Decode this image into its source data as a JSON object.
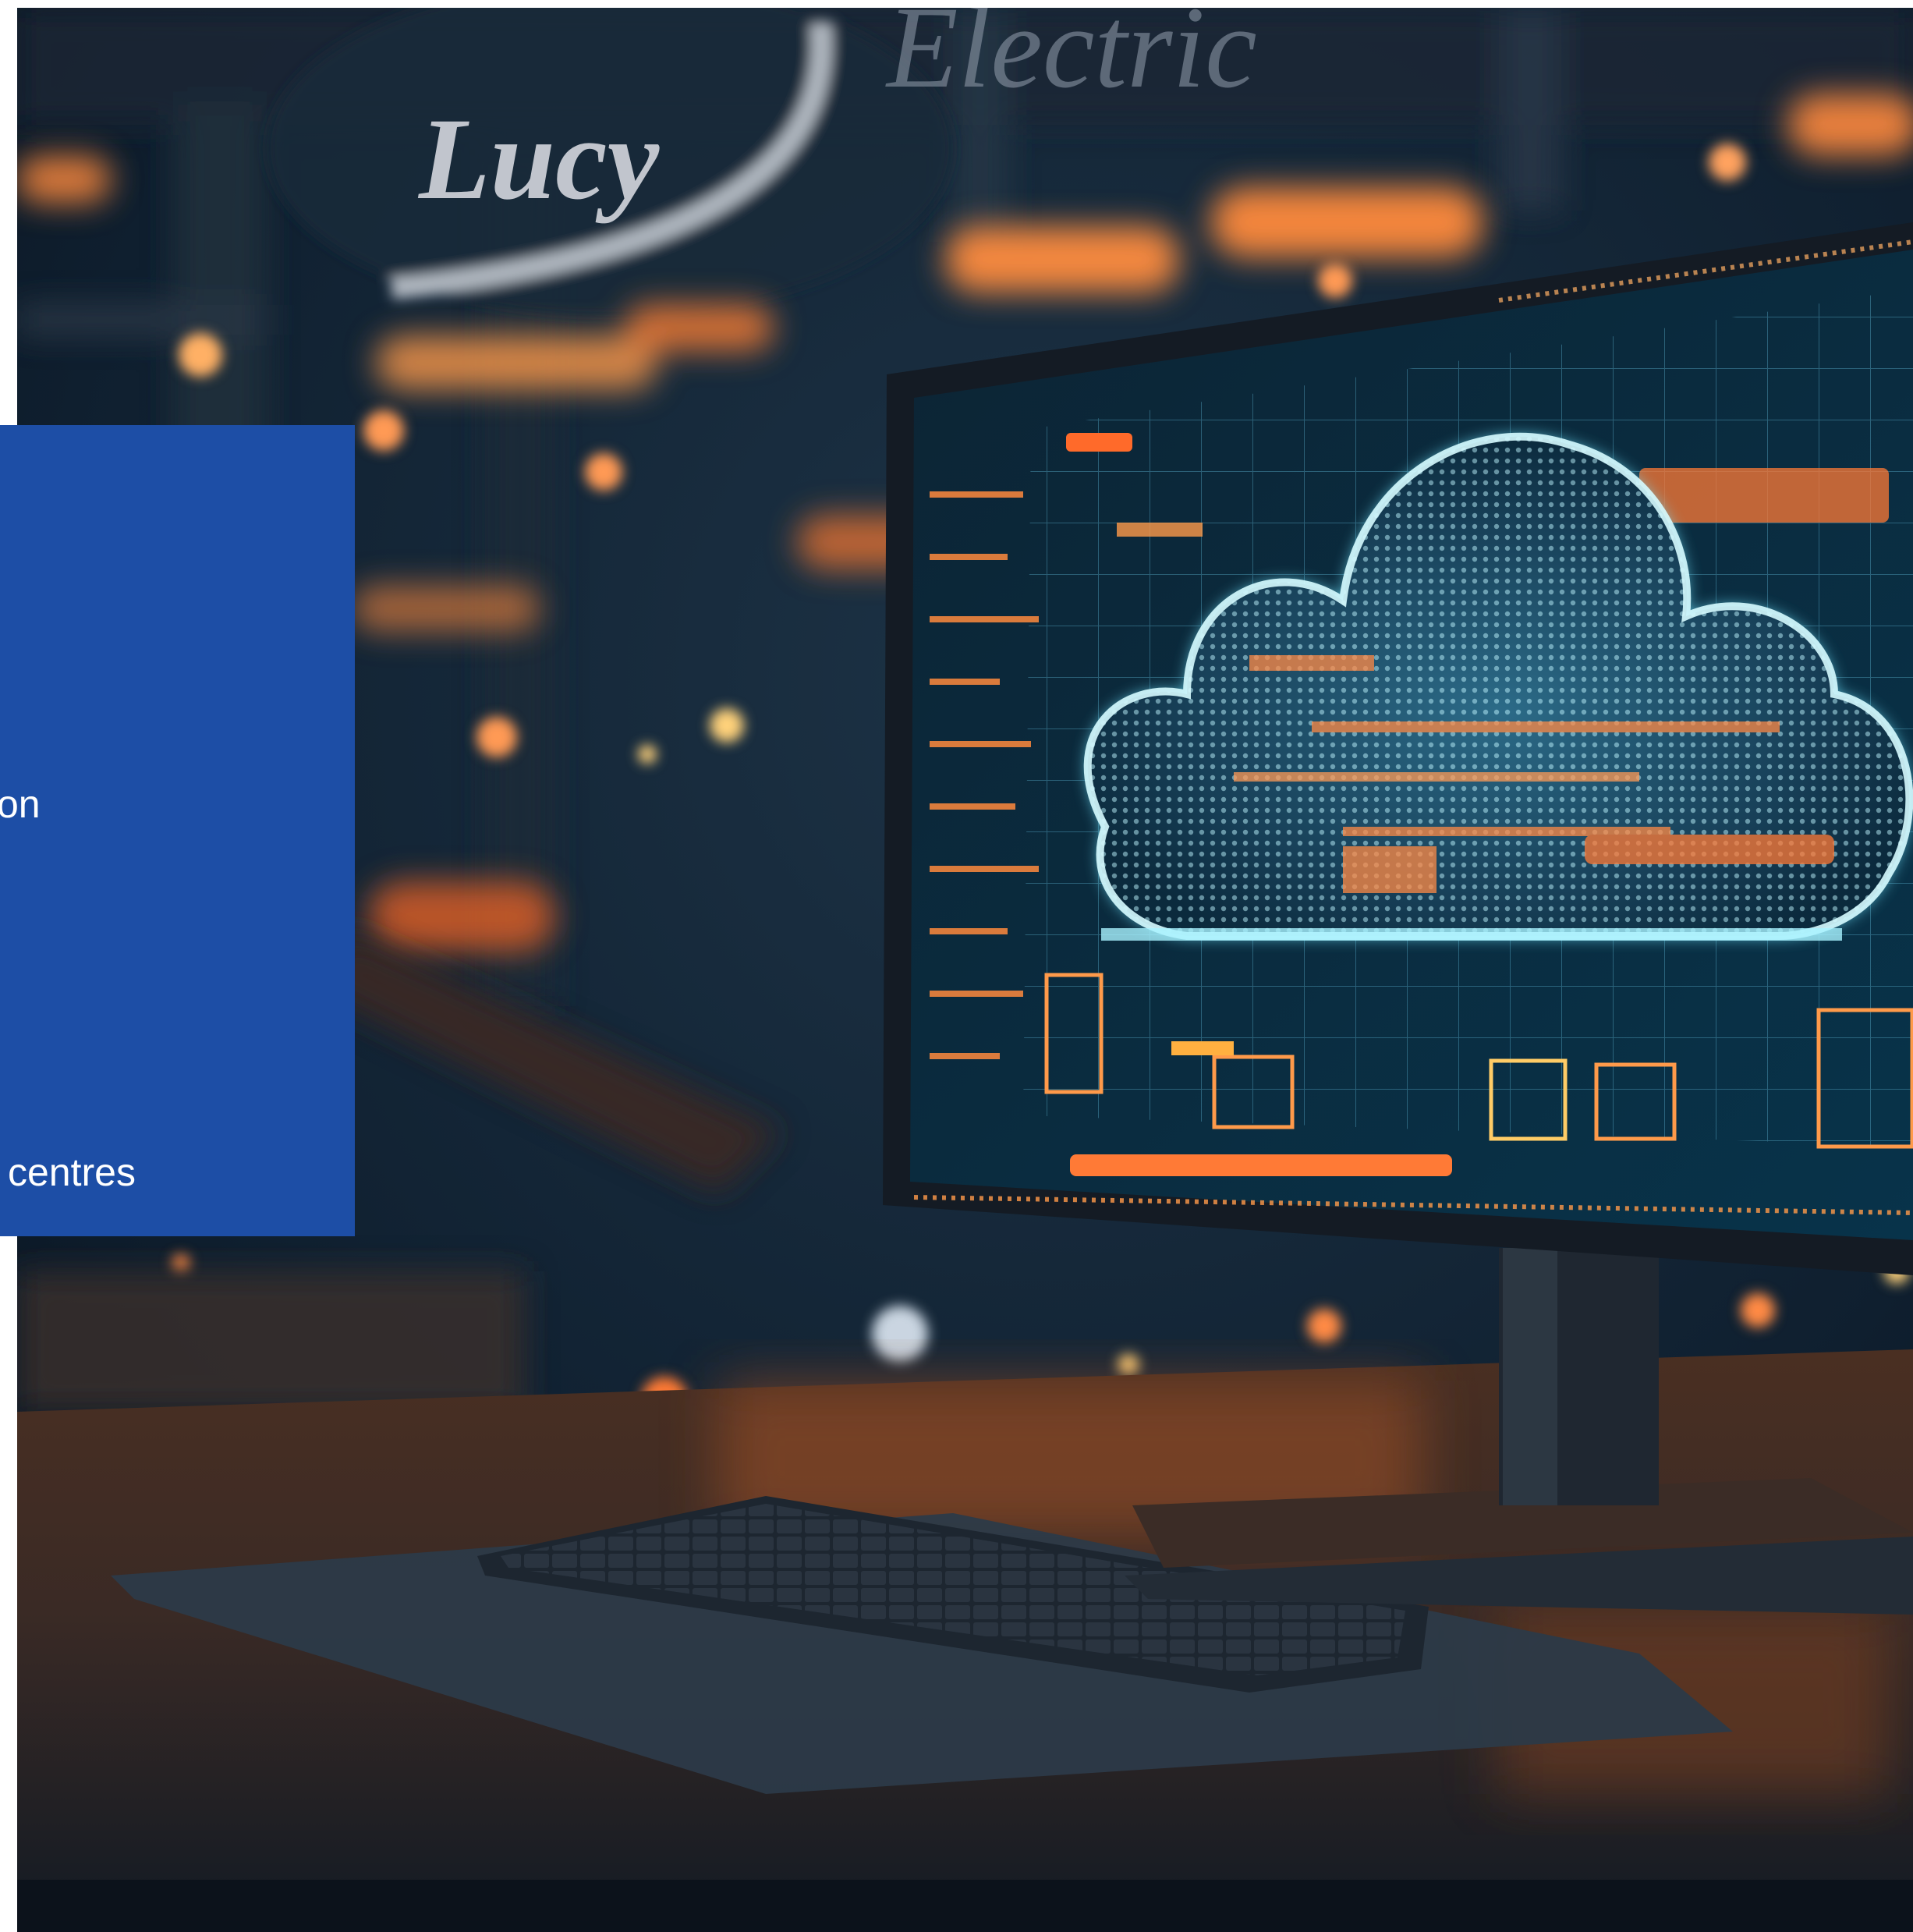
{
  "sign": {
    "brand": "Lucy",
    "sub": "Electric"
  },
  "panel": {
    "background": "#1d4ea6",
    "line_1": "on",
    "line_2": "centres"
  },
  "scene": {
    "description_icons": [
      "cloud-icon",
      "monitor",
      "keyboard"
    ],
    "colors": {
      "background_dark": "#0d1a2a",
      "accent_orange": "#ff8a3d",
      "accent_cyan": "#6fe6ff"
    }
  }
}
